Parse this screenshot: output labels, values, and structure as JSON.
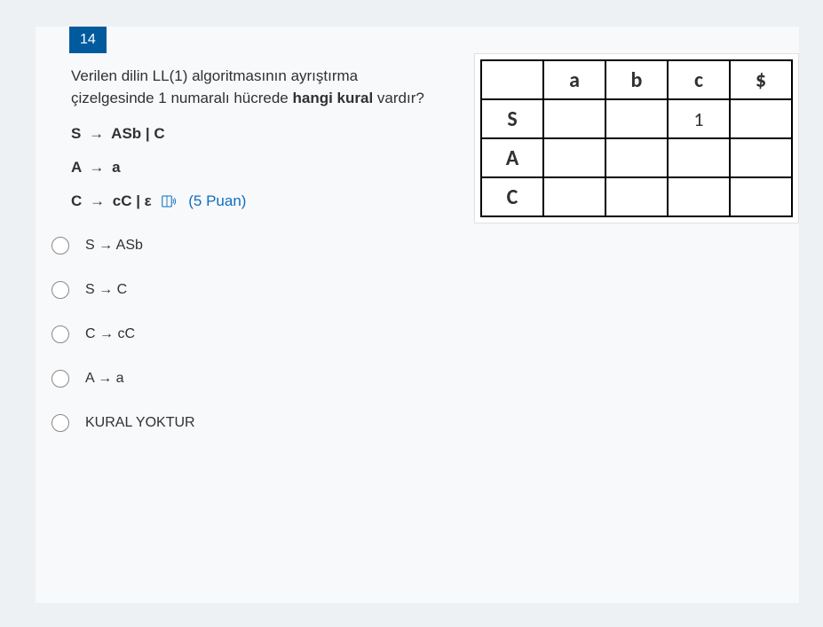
{
  "question": {
    "number": "14",
    "text_parts": {
      "p1a": "Verilen dilin LL(1) algoritmasının ayrıştırma çizelgesinde 1 numaralı hücrede ",
      "p1b": "hangi kural",
      "p1c": " vardır?"
    },
    "grammar": {
      "r1_lhs": "S",
      "r1_rhs": "ASb | C",
      "r2_lhs": "A",
      "r2_rhs": "a",
      "r3_lhs": "C",
      "r3_rhs": "cC | ε"
    },
    "points": "(5 Puan)"
  },
  "options": [
    {
      "label": "S → ASb"
    },
    {
      "label": "S →  C"
    },
    {
      "label": "C → cC"
    },
    {
      "label": "A →  a"
    },
    {
      "label": "KURAL YOKTUR"
    }
  ],
  "chart_data": {
    "type": "table",
    "columns": [
      "",
      "a",
      "b",
      "c",
      "$"
    ],
    "rows": [
      {
        "header": "S",
        "cells": [
          "",
          "",
          "1",
          ""
        ]
      },
      {
        "header": "A",
        "cells": [
          "",
          "",
          "",
          ""
        ]
      },
      {
        "header": "C",
        "cells": [
          "",
          "",
          "",
          ""
        ]
      }
    ]
  }
}
